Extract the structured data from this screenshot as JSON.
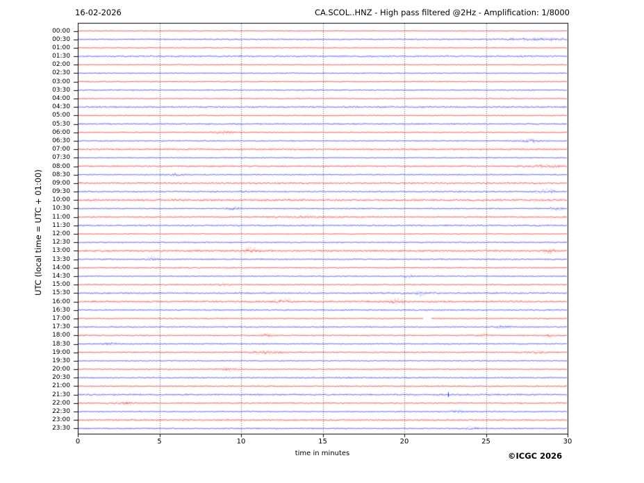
{
  "header": {
    "date": "16-02-2026",
    "title": "CA.SCOL..HNZ - High pass filtered @2Hz - Amplification: 1/8000"
  },
  "axes": {
    "x_label": "time in minutes",
    "x_ticks": [
      0,
      5,
      10,
      15,
      20,
      25,
      30
    ],
    "x_range": [
      0,
      30
    ],
    "y_label": "UTC (local time = UTC + 01:00)",
    "grid": "vertical dotted lines every 5 minutes"
  },
  "footer": {
    "copyright": "©ICGC 2026"
  },
  "colors": {
    "trace_hour": "#ff0000",
    "trace_half_hour": "#0000ff",
    "grid": "#555555",
    "frame": "#000000",
    "background": "#ffffff",
    "text": "#000000"
  },
  "chart_data": {
    "type": "line",
    "subtype": "helicorder-seismogram",
    "title": "CA.SCOL..HNZ - High pass filtered @2Hz - Amplification: 1/8000",
    "date": "16-02-2026",
    "station": "CA.SCOL..HNZ",
    "filter": "High pass filtered @2Hz",
    "amplification": "1/8000",
    "xlabel": "time in minutes",
    "ylabel": "UTC (local time = UTC + 01:00)",
    "xlim": [
      0,
      30
    ],
    "x_ticks": [
      0,
      5,
      10,
      15,
      20,
      25,
      30
    ],
    "row_duration_minutes": 30,
    "legend_position": "none",
    "grid": "vertical dotted gridlines at 5-minute intervals",
    "amplitude_note": "noise level is a qualitative trace fuzziness 1(quiet)-3(noisy); events give minute positions of visible bursts/spikes/gaps",
    "rows": [
      {
        "utc": "00:00",
        "color": "red",
        "noise": 1.0,
        "events": []
      },
      {
        "utc": "00:30",
        "color": "blue",
        "noise": 1.5,
        "events": [
          {
            "type": "burst",
            "t": 28.0,
            "w": 4.0,
            "amp": 1.2
          }
        ]
      },
      {
        "utc": "01:00",
        "color": "red",
        "noise": 1.0,
        "events": []
      },
      {
        "utc": "01:30",
        "color": "blue",
        "noise": 2.0,
        "events": []
      },
      {
        "utc": "02:00",
        "color": "red",
        "noise": 1.0,
        "events": []
      },
      {
        "utc": "02:30",
        "color": "blue",
        "noise": 1.0,
        "events": []
      },
      {
        "utc": "03:00",
        "color": "red",
        "noise": 1.0,
        "events": []
      },
      {
        "utc": "03:30",
        "color": "blue",
        "noise": 1.2,
        "events": []
      },
      {
        "utc": "04:00",
        "color": "red",
        "noise": 1.0,
        "events": []
      },
      {
        "utc": "04:30",
        "color": "blue",
        "noise": 2.2,
        "events": []
      },
      {
        "utc": "05:00",
        "color": "red",
        "noise": 1.0,
        "events": []
      },
      {
        "utc": "05:30",
        "color": "blue",
        "noise": 1.8,
        "events": []
      },
      {
        "utc": "06:00",
        "color": "red",
        "noise": 1.2,
        "events": [
          {
            "type": "burst",
            "t": 8.9,
            "w": 1.0,
            "amp": 1.5
          }
        ]
      },
      {
        "utc": "06:30",
        "color": "blue",
        "noise": 1.3,
        "events": [
          {
            "type": "burst",
            "t": 27.8,
            "w": 1.5,
            "amp": 1.5
          }
        ]
      },
      {
        "utc": "07:00",
        "color": "red",
        "noise": 2.3,
        "events": []
      },
      {
        "utc": "07:30",
        "color": "blue",
        "noise": 1.0,
        "events": []
      },
      {
        "utc": "08:00",
        "color": "red",
        "noise": 1.8,
        "events": [
          {
            "type": "burst",
            "t": 28.5,
            "w": 2.0,
            "amp": 1.0
          }
        ]
      },
      {
        "utc": "08:30",
        "color": "blue",
        "noise": 1.3,
        "events": [
          {
            "type": "burst",
            "t": 6.1,
            "w": 0.8,
            "amp": 1.5
          }
        ]
      },
      {
        "utc": "09:00",
        "color": "red",
        "noise": 2.2,
        "events": []
      },
      {
        "utc": "09:30",
        "color": "blue",
        "noise": 1.7,
        "events": [
          {
            "type": "burst",
            "t": 28.7,
            "w": 1.0,
            "amp": 1.5
          }
        ]
      },
      {
        "utc": "10:00",
        "color": "red",
        "noise": 2.8,
        "events": []
      },
      {
        "utc": "10:30",
        "color": "blue",
        "noise": 1.3,
        "events": [
          {
            "type": "burst",
            "t": 9.5,
            "w": 0.7,
            "amp": 1.8
          },
          {
            "type": "burst",
            "t": 29.3,
            "w": 0.7,
            "amp": 1.5
          }
        ]
      },
      {
        "utc": "11:00",
        "color": "red",
        "noise": 1.8,
        "events": [
          {
            "type": "burst",
            "t": 14.0,
            "w": 3.0,
            "amp": 0.8
          }
        ]
      },
      {
        "utc": "11:30",
        "color": "blue",
        "noise": 1.8,
        "events": []
      },
      {
        "utc": "12:00",
        "color": "red",
        "noise": 1.0,
        "events": []
      },
      {
        "utc": "12:30",
        "color": "blue",
        "noise": 1.4,
        "events": []
      },
      {
        "utc": "13:00",
        "color": "red",
        "noise": 2.8,
        "events": [
          {
            "type": "burst",
            "t": 10.6,
            "w": 0.8,
            "amp": 1.5
          },
          {
            "type": "burst",
            "t": 28.9,
            "w": 0.6,
            "amp": 1.2
          }
        ]
      },
      {
        "utc": "13:30",
        "color": "blue",
        "noise": 1.7,
        "events": [
          {
            "type": "burst",
            "t": 4.5,
            "w": 0.6,
            "amp": 1.5
          }
        ]
      },
      {
        "utc": "14:00",
        "color": "red",
        "noise": 1.4,
        "events": []
      },
      {
        "utc": "14:30",
        "color": "blue",
        "noise": 1.1,
        "events": [
          {
            "type": "burst",
            "t": 20.3,
            "w": 0.6,
            "amp": 1.5
          }
        ]
      },
      {
        "utc": "15:00",
        "color": "red",
        "noise": 1.3,
        "events": [
          {
            "type": "burst",
            "t": 8.9,
            "w": 1.0,
            "amp": 1.6
          }
        ]
      },
      {
        "utc": "15:30",
        "color": "blue",
        "noise": 2.2,
        "events": [
          {
            "type": "burst",
            "t": 21.0,
            "w": 0.7,
            "amp": 1.5
          }
        ]
      },
      {
        "utc": "16:00",
        "color": "red",
        "noise": 2.6,
        "events": [
          {
            "type": "burst",
            "t": 12.5,
            "w": 0.8,
            "amp": 1.6
          },
          {
            "type": "burst",
            "t": 19.5,
            "w": 0.8,
            "amp": 1.3
          }
        ]
      },
      {
        "utc": "16:30",
        "color": "blue",
        "noise": 1.8,
        "events": []
      },
      {
        "utc": "17:00",
        "color": "red",
        "noise": 1.3,
        "events": [
          {
            "type": "gap",
            "t": 21.4,
            "w": 0.5
          }
        ]
      },
      {
        "utc": "17:30",
        "color": "blue",
        "noise": 1.4,
        "events": [
          {
            "type": "burst",
            "t": 26.1,
            "w": 0.8,
            "amp": 1.4
          }
        ]
      },
      {
        "utc": "18:00",
        "color": "red",
        "noise": 1.4,
        "events": [
          {
            "type": "burst",
            "t": 11.6,
            "w": 0.6,
            "amp": 1.6
          },
          {
            "type": "burst",
            "t": 24.9,
            "w": 0.6,
            "amp": 1.4
          },
          {
            "type": "burst",
            "t": 28.9,
            "w": 0.5,
            "amp": 1.8
          }
        ]
      },
      {
        "utc": "18:30",
        "color": "blue",
        "noise": 1.4,
        "events": [
          {
            "type": "burst",
            "t": 2.0,
            "w": 0.7,
            "amp": 1.5
          }
        ]
      },
      {
        "utc": "19:00",
        "color": "red",
        "noise": 1.4,
        "events": [
          {
            "type": "burst",
            "t": 11.5,
            "w": 1.5,
            "amp": 1.5
          },
          {
            "type": "burst",
            "t": 28.0,
            "w": 1.2,
            "amp": 1.2
          }
        ]
      },
      {
        "utc": "19:30",
        "color": "blue",
        "noise": 1.0,
        "events": []
      },
      {
        "utc": "20:00",
        "color": "red",
        "noise": 1.3,
        "events": [
          {
            "type": "burst",
            "t": 9.3,
            "w": 1.0,
            "amp": 1.6
          }
        ]
      },
      {
        "utc": "20:30",
        "color": "blue",
        "noise": 1.4,
        "events": []
      },
      {
        "utc": "21:00",
        "color": "red",
        "noise": 1.7,
        "events": []
      },
      {
        "utc": "21:30",
        "color": "blue",
        "noise": 2.2,
        "events": [
          {
            "type": "spike",
            "t": 22.7,
            "amp": 3.5
          }
        ]
      },
      {
        "utc": "22:00",
        "color": "red",
        "noise": 1.7,
        "events": [
          {
            "type": "burst",
            "t": 2.7,
            "w": 1.0,
            "amp": 1.6
          }
        ]
      },
      {
        "utc": "22:30",
        "color": "blue",
        "noise": 1.3,
        "events": [
          {
            "type": "burst",
            "t": 23.3,
            "w": 0.6,
            "amp": 1.2
          }
        ]
      },
      {
        "utc": "23:00",
        "color": "red",
        "noise": 2.2,
        "events": []
      },
      {
        "utc": "23:30",
        "color": "blue",
        "noise": 1.4,
        "events": [
          {
            "type": "burst",
            "t": 24.2,
            "w": 0.8,
            "amp": 1.4
          }
        ]
      }
    ]
  }
}
